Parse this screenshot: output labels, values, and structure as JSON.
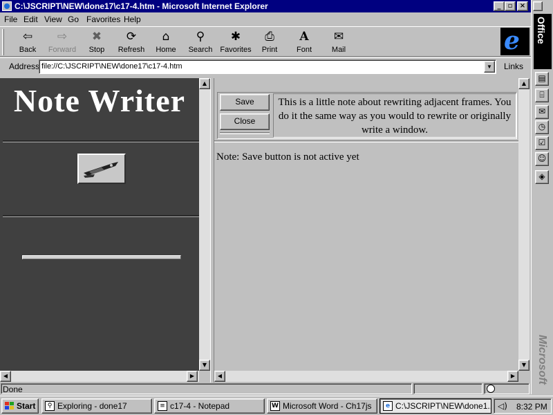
{
  "window": {
    "title": "C:\\JSCRIPT\\NEW\\done17\\c17-4.htm - Microsoft Internet Explorer",
    "min_glyph": "_",
    "max_glyph": "▫",
    "close_glyph": "×"
  },
  "menu": {
    "items": [
      {
        "label": "File"
      },
      {
        "label": "Edit"
      },
      {
        "label": "View"
      },
      {
        "label": "Go"
      },
      {
        "label": "Favorites"
      },
      {
        "label": "Help"
      }
    ]
  },
  "toolbar": {
    "buttons": [
      {
        "label": "Back",
        "icon": "back-arrow-icon",
        "glyph": "⇦"
      },
      {
        "label": "Forward",
        "icon": "forward-arrow-icon",
        "glyph": "⇨",
        "disabled": true
      },
      {
        "label": "Stop",
        "icon": "stop-icon",
        "glyph": "✖"
      },
      {
        "label": "Refresh",
        "icon": "refresh-icon",
        "glyph": "⟳"
      },
      {
        "label": "Home",
        "icon": "home-icon",
        "glyph": "⌂"
      },
      {
        "label": "Search",
        "icon": "search-icon",
        "glyph": "⚲"
      },
      {
        "label": "Favorites",
        "icon": "favorites-folder-icon",
        "glyph": "✱"
      },
      {
        "label": "Print",
        "icon": "printer-icon",
        "glyph": "⎙"
      },
      {
        "label": "Font",
        "icon": "font-icon",
        "glyph": "A"
      },
      {
        "label": "Mail",
        "icon": "mail-icon",
        "glyph": "✉"
      }
    ],
    "logo_glyph": "e"
  },
  "address": {
    "label": "Address",
    "value": "file://C:\\JSCRIPT\\NEW\\done17\\c17-4.htm",
    "links_label": "Links"
  },
  "left_frame": {
    "title": "Note Writer"
  },
  "right_frame": {
    "save_label": "Save",
    "close_label": "Close",
    "note_text": "This is a little note about rewriting adjacent frames. You do it the same way as you would to rewrite or originally write a window.",
    "status_note": "Note: Save button is not active yet"
  },
  "statusbar": {
    "text": "Done"
  },
  "officebar": {
    "office_label": "Office",
    "microsoft_label": "Microsoft"
  },
  "taskbar": {
    "start_label": "Start",
    "tasks": [
      {
        "label": "Exploring - done17",
        "icon": "explorer-icon",
        "glyph": "🔍"
      },
      {
        "label": "c17-4 - Notepad",
        "icon": "notepad-icon",
        "glyph": "≡"
      },
      {
        "label": "Microsoft Word - Ch17js",
        "icon": "word-icon",
        "glyph": "W"
      },
      {
        "label": "C:\\JSCRIPT\\NEW\\done1...",
        "icon": "ie-page-icon",
        "glyph": "e"
      }
    ],
    "time": "8:32 PM"
  }
}
